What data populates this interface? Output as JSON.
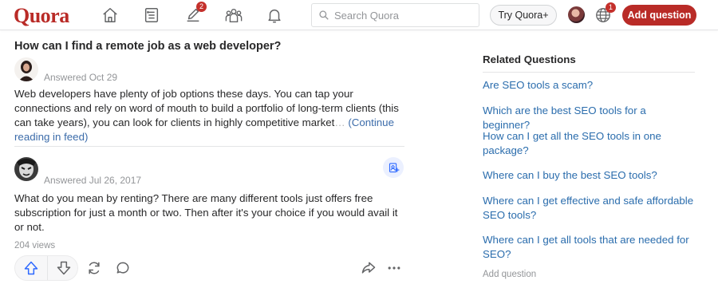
{
  "header": {
    "logo": "Quora",
    "icons": {
      "home": "home-icon",
      "following": "following-icon",
      "answer": "answer-icon",
      "spaces": "spaces-icon",
      "notifications": "bell-icon"
    },
    "answer_badge": "2",
    "search_placeholder": "Search Quora",
    "try_label": "Try Quora+",
    "lang_badge": "1",
    "add_question_label": "Add question",
    "brand_color": "#b92b27"
  },
  "question": {
    "title": "How can I find a remote job as a web developer?"
  },
  "answers": [
    {
      "meta": "Answered Oct 29",
      "text_main": "Web developers have plenty of job options these days. You can tap your connections and rely on word of mouth to build a portfolio of long-term clients (this can take years), you can look for clients in highly competitive market",
      "text_fade": "…",
      "continue_label": "(Continue reading in feed)"
    },
    {
      "meta": "Answered Jul 26, 2017",
      "text": "What do you mean by renting? There are many different tools just offers free subscription for just a month or two. Then after it's your choice if you would avail it or not.",
      "views": "204 views"
    }
  ],
  "related": {
    "title": "Related Questions",
    "items": [
      "Are SEO tools a scam?",
      "Which are the best SEO tools for a beginner?",
      "How can I get all the SEO tools in one package?",
      "Where can I buy the best SEO tools?",
      "Where can I get effective and safe affordable SEO tools?",
      "Where can I get all tools that are needed for SEO?"
    ],
    "add_question": "Add question",
    "link_color": "#2b6dad"
  }
}
